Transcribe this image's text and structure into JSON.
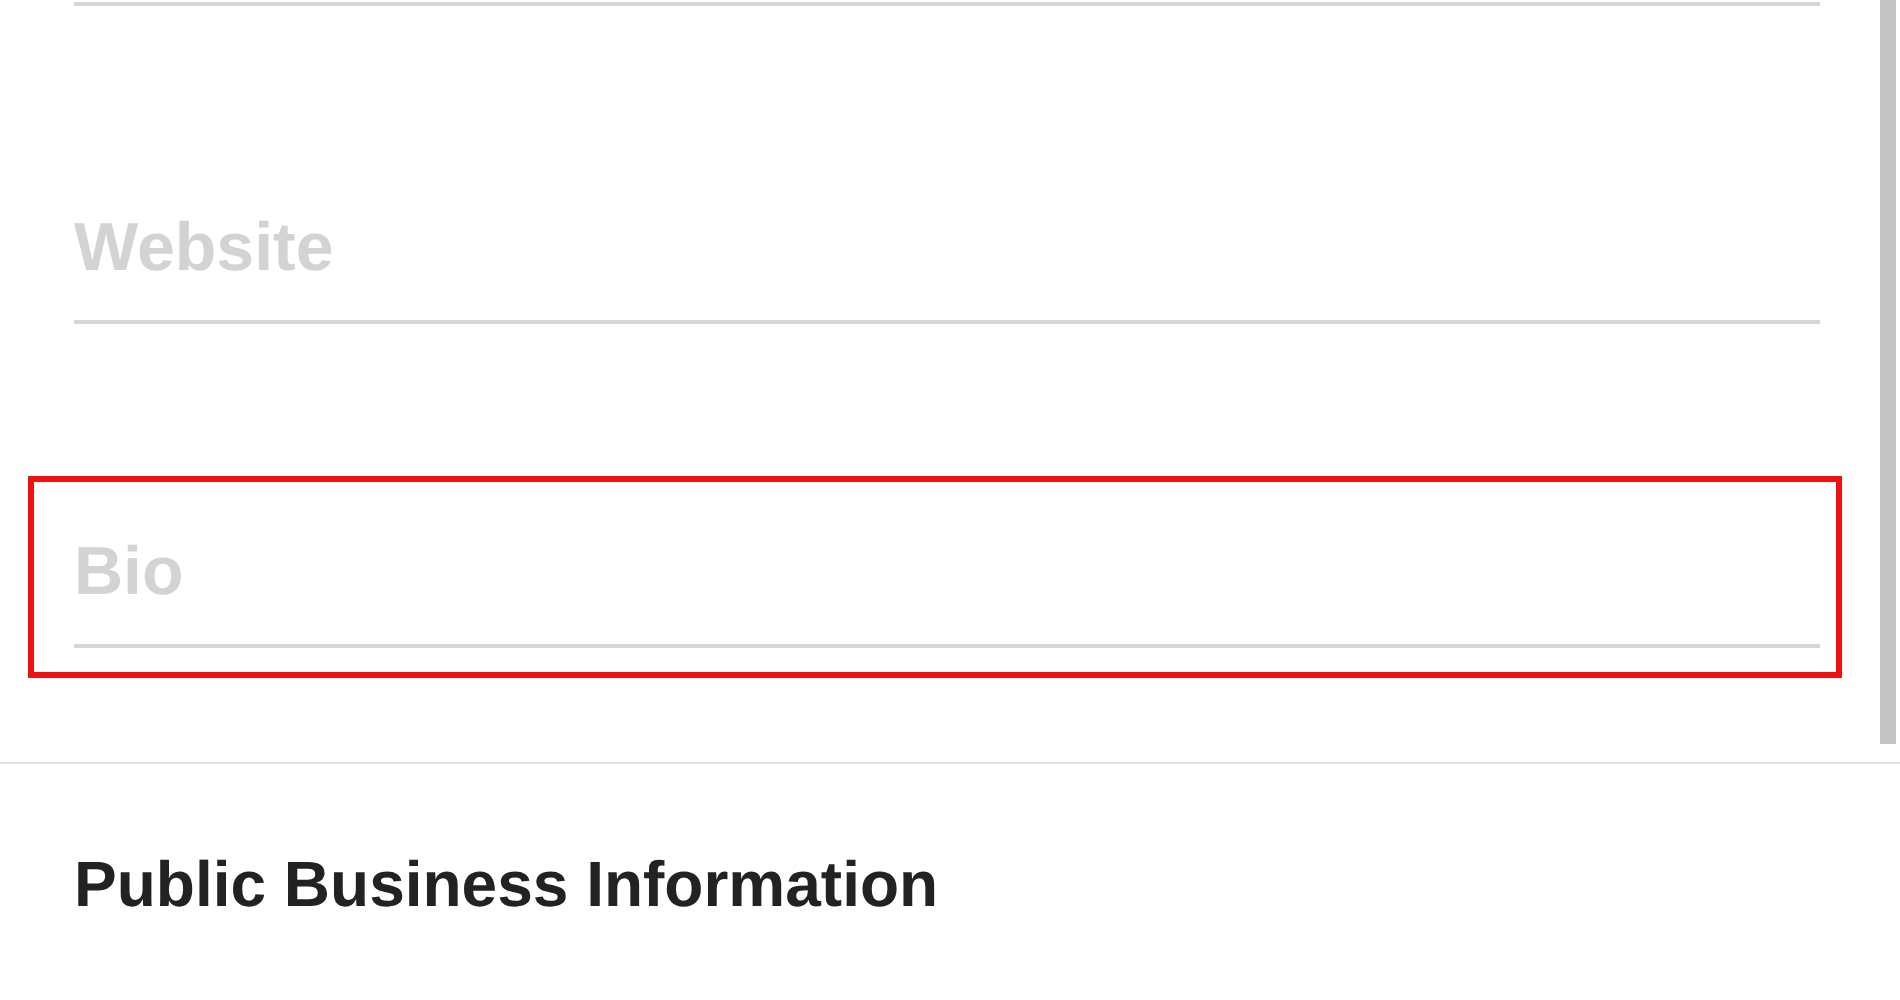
{
  "fields": [
    {
      "placeholder": "Website",
      "highlighted": false
    },
    {
      "placeholder": "Bio",
      "highlighted": true
    }
  ],
  "section_title": "Public Business Information"
}
